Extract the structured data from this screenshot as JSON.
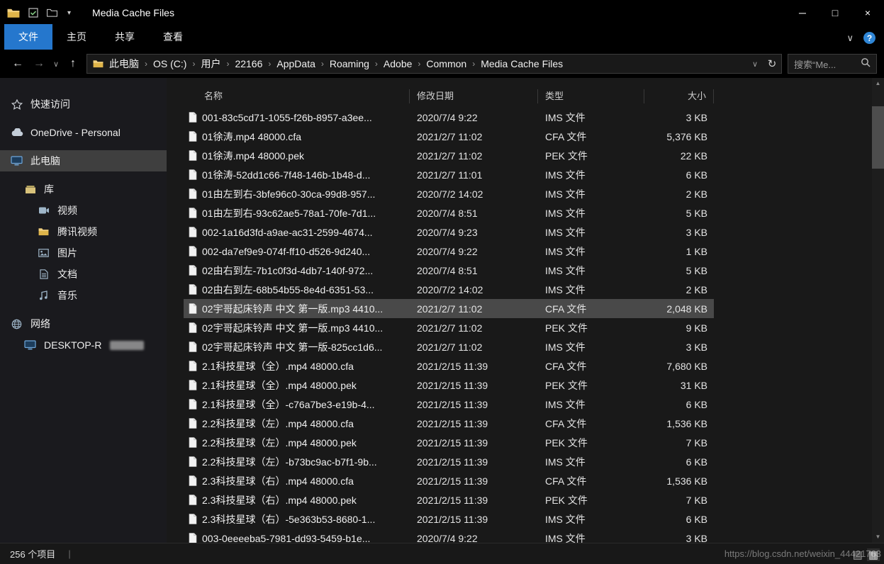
{
  "window": {
    "title": "Media Cache Files"
  },
  "ribbon": {
    "tabs": [
      {
        "id": "file",
        "label": "文件",
        "active": true
      },
      {
        "id": "home",
        "label": "主页"
      },
      {
        "id": "share",
        "label": "共享"
      },
      {
        "id": "view",
        "label": "查看"
      }
    ]
  },
  "address_bar": {
    "breadcrumbs": [
      {
        "id": "this-pc",
        "label": "此电脑"
      },
      {
        "id": "os-c",
        "label": "OS (C:)"
      },
      {
        "id": "users",
        "label": "用户"
      },
      {
        "id": "user-22166",
        "label": "22166"
      },
      {
        "id": "appdata",
        "label": "AppData"
      },
      {
        "id": "roaming",
        "label": "Roaming"
      },
      {
        "id": "adobe",
        "label": "Adobe"
      },
      {
        "id": "common",
        "label": "Common"
      },
      {
        "id": "media-cache-files",
        "label": "Media Cache Files"
      }
    ],
    "search_placeholder": "搜索“Me..."
  },
  "sidebar": {
    "items": [
      {
        "id": "quick-access",
        "label": "快速访问",
        "icon": "star",
        "indent": 0
      },
      {
        "id": "onedrive",
        "label": "OneDrive - Personal",
        "icon": "cloud",
        "indent": 0,
        "section_start": true
      },
      {
        "id": "this-pc",
        "label": "此电脑",
        "icon": "computer",
        "indent": 0,
        "selected": true,
        "section_start": true
      },
      {
        "id": "libraries",
        "label": "库",
        "icon": "library",
        "indent": 1,
        "section_start": true
      },
      {
        "id": "videos",
        "label": "视频",
        "icon": "video",
        "indent": 2
      },
      {
        "id": "tencent-video",
        "label": "腾讯视频",
        "icon": "folder",
        "indent": 2
      },
      {
        "id": "pictures",
        "label": "图片",
        "icon": "picture",
        "indent": 2
      },
      {
        "id": "documents",
        "label": "文档",
        "icon": "document",
        "indent": 2
      },
      {
        "id": "music",
        "label": "音乐",
        "icon": "music",
        "indent": 2
      },
      {
        "id": "network",
        "label": "网络",
        "icon": "network",
        "indent": 0,
        "section_start": true
      },
      {
        "id": "desktop-r",
        "label": "DESKTOP-R",
        "icon": "computer",
        "indent": 1,
        "redacted": true
      }
    ]
  },
  "file_list": {
    "columns": [
      {
        "id": "name",
        "label": "名称"
      },
      {
        "id": "date",
        "label": "修改日期"
      },
      {
        "id": "type",
        "label": "类型"
      },
      {
        "id": "size",
        "label": "大小"
      }
    ],
    "rows": [
      {
        "name": "001-83c5cd71-1055-f26b-8957-a3ee...",
        "date": "2020/7/4 9:22",
        "type": "IMS 文件",
        "size": "3 KB"
      },
      {
        "name": "01徐涛.mp4 48000.cfa",
        "date": "2021/2/7 11:02",
        "type": "CFA 文件",
        "size": "5,376 KB"
      },
      {
        "name": "01徐涛.mp4 48000.pek",
        "date": "2021/2/7 11:02",
        "type": "PEK 文件",
        "size": "22 KB"
      },
      {
        "name": "01徐涛-52dd1c66-7f48-146b-1b48-d...",
        "date": "2021/2/7 11:01",
        "type": "IMS 文件",
        "size": "6 KB"
      },
      {
        "name": "01由左到右-3bfe96c0-30ca-99d8-957...",
        "date": "2020/7/2 14:02",
        "type": "IMS 文件",
        "size": "2 KB"
      },
      {
        "name": "01由左到右-93c62ae5-78a1-70fe-7d1...",
        "date": "2020/7/4 8:51",
        "type": "IMS 文件",
        "size": "5 KB"
      },
      {
        "name": "002-1a16d3fd-a9ae-ac31-2599-4674...",
        "date": "2020/7/4 9:23",
        "type": "IMS 文件",
        "size": "3 KB"
      },
      {
        "name": "002-da7ef9e9-074f-ff10-d526-9d240...",
        "date": "2020/7/4 9:22",
        "type": "IMS 文件",
        "size": "1 KB"
      },
      {
        "name": "02由右到左-7b1c0f3d-4db7-140f-972...",
        "date": "2020/7/4 8:51",
        "type": "IMS 文件",
        "size": "5 KB"
      },
      {
        "name": "02由右到左-68b54b55-8e4d-6351-53...",
        "date": "2020/7/2 14:02",
        "type": "IMS 文件",
        "size": "2 KB"
      },
      {
        "name": "02宇哥起床铃声 中文 第一版.mp3 4410...",
        "date": "2021/2/7 11:02",
        "type": "CFA 文件",
        "size": "2,048 KB",
        "selected": true
      },
      {
        "name": "02宇哥起床铃声 中文 第一版.mp3 4410...",
        "date": "2021/2/7 11:02",
        "type": "PEK 文件",
        "size": "9 KB"
      },
      {
        "name": "02宇哥起床铃声 中文 第一版-825cc1d6...",
        "date": "2021/2/7 11:02",
        "type": "IMS 文件",
        "size": "3 KB"
      },
      {
        "name": "2.1科技星球（全）.mp4 48000.cfa",
        "date": "2021/2/15 11:39",
        "type": "CFA 文件",
        "size": "7,680 KB"
      },
      {
        "name": "2.1科技星球（全）.mp4 48000.pek",
        "date": "2021/2/15 11:39",
        "type": "PEK 文件",
        "size": "31 KB"
      },
      {
        "name": "2.1科技星球（全）-c76a7be3-e19b-4...",
        "date": "2021/2/15 11:39",
        "type": "IMS 文件",
        "size": "6 KB"
      },
      {
        "name": "2.2科技星球（左）.mp4 48000.cfa",
        "date": "2021/2/15 11:39",
        "type": "CFA 文件",
        "size": "1,536 KB"
      },
      {
        "name": "2.2科技星球（左）.mp4 48000.pek",
        "date": "2021/2/15 11:39",
        "type": "PEK 文件",
        "size": "7 KB"
      },
      {
        "name": "2.2科技星球（左）-b73bc9ac-b7f1-9b...",
        "date": "2021/2/15 11:39",
        "type": "IMS 文件",
        "size": "6 KB"
      },
      {
        "name": "2.3科技星球（右）.mp4 48000.cfa",
        "date": "2021/2/15 11:39",
        "type": "CFA 文件",
        "size": "1,536 KB"
      },
      {
        "name": "2.3科技星球（右）.mp4 48000.pek",
        "date": "2021/2/15 11:39",
        "type": "PEK 文件",
        "size": "7 KB"
      },
      {
        "name": "2.3科技星球（右）-5e363b53-8680-1...",
        "date": "2021/2/15 11:39",
        "type": "IMS 文件",
        "size": "6 KB"
      },
      {
        "name": "003-0eeeeba5-7981-dd93-5459-b1e...",
        "date": "2020/7/4 9:22",
        "type": "IMS 文件",
        "size": "3 KB"
      }
    ]
  },
  "status_bar": {
    "items_count": "256 个项目"
  },
  "watermark": "https://blog.csdn.net/weixin_44421763"
}
